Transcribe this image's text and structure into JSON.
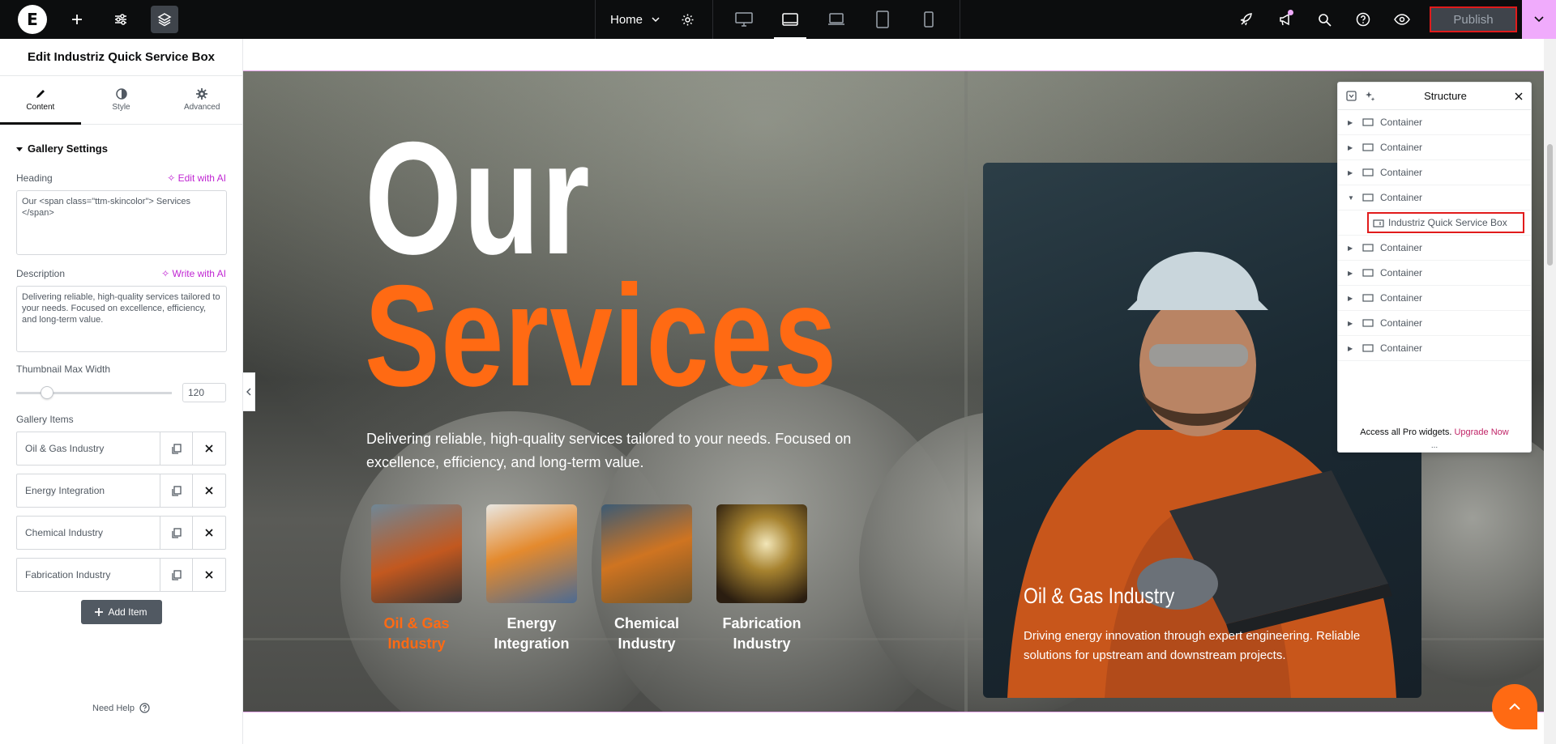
{
  "topbar": {
    "page_name": "Home",
    "publish_label": "Publish",
    "devices": [
      "desktop",
      "tablet-landscape",
      "laptop",
      "tablet",
      "mobile"
    ]
  },
  "panel": {
    "title": "Edit Industriz Quick Service Box",
    "tabs": [
      {
        "label": "Content"
      },
      {
        "label": "Style"
      },
      {
        "label": "Advanced"
      }
    ],
    "section_title": "Gallery Settings",
    "heading_label": "Heading",
    "heading_ai": "Edit with AI",
    "heading_value": "Our <span class=\"ttm-skincolor\"> Services </span>",
    "description_label": "Description",
    "description_ai": "Write with AI",
    "description_value": "Delivering reliable, high-quality services tailored to your needs. Focused on excellence, efficiency, and long-term value.",
    "thumb_label": "Thumbnail Max Width",
    "thumb_value": "120",
    "thumb_fraction": 0.2,
    "gallery_label": "Gallery Items",
    "items": [
      {
        "title": "Oil & Gas Industry"
      },
      {
        "title": "Energy Integration"
      },
      {
        "title": "Chemical Industry"
      },
      {
        "title": "Fabrication Industry"
      }
    ],
    "add_item": "Add Item",
    "need_help": "Need Help"
  },
  "hero": {
    "heading_white": "Our",
    "heading_orange": "Services",
    "description": "Delivering reliable, high-quality services tailored to your needs. Focused on excellence, efficiency, and long-term value.",
    "thumbs": [
      {
        "line1": "Oil & Gas",
        "line2": "Industry",
        "active": true
      },
      {
        "line1": "Energy",
        "line2": "Integration",
        "active": false
      },
      {
        "line1": "Chemical",
        "line2": "Industry",
        "active": false
      },
      {
        "line1": "Fabrication",
        "line2": "Industry",
        "active": false
      }
    ],
    "feature_title": "Oil & Gas Industry",
    "feature_desc": "Driving energy innovation through expert engineering. Reliable solutions for upstream and downstream projects."
  },
  "structure": {
    "title": "Structure",
    "rows": [
      {
        "label": "Container",
        "expanded": false
      },
      {
        "label": "Container",
        "expanded": false
      },
      {
        "label": "Container",
        "expanded": false
      },
      {
        "label": "Container",
        "expanded": true
      },
      {
        "label": "Industriz Quick Service Box",
        "child": true
      },
      {
        "label": "Container",
        "expanded": false
      },
      {
        "label": "Container",
        "expanded": false
      },
      {
        "label": "Container",
        "expanded": false
      },
      {
        "label": "Container",
        "expanded": false
      },
      {
        "label": "Container",
        "expanded": false
      }
    ],
    "footer_text": "Access all Pro widgets.",
    "footer_link": "Upgrade Now",
    "dots": "..."
  },
  "colors": {
    "accent": "#ff6a13",
    "topbar": "#0c0d0e",
    "publish_highlight": "#e11b1b",
    "ai_link": "#c026d3"
  }
}
